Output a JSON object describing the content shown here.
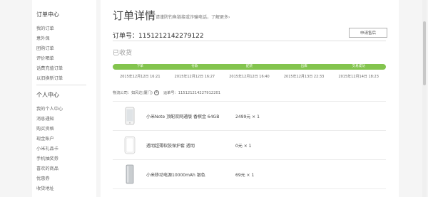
{
  "sidebar": {
    "groups": [
      {
        "title": "订单中心",
        "items": [
          "我的订单",
          "意外保",
          "团购订单",
          "评价晒单",
          "话费充值订单",
          "以旧换新订单"
        ]
      },
      {
        "title": "个人中心",
        "items": [
          "我的个人中心",
          "消息通知",
          "购买资格",
          "现金账户",
          "小米礼品卡",
          "手机抽奖券",
          "喜欢的商品",
          "优惠券",
          "收货地址"
        ]
      }
    ]
  },
  "main": {
    "title": "订单详情",
    "hint": "请谨防钓鱼链接或诈骗电话，了解更多›",
    "order_label": "订单号：",
    "order_number": "1151212142279122",
    "aftersale_button": "申请售后",
    "status": "已收货",
    "progress_steps": [
      "下单",
      "付款",
      "配货",
      "出库",
      "交易成功"
    ],
    "progress_times": [
      "2015年12月12日 16:21",
      "2015年12月12日 16:27",
      "2015年12月12日 16:40",
      "2015年12月13日 22:33",
      "2015年12月14日 18:23"
    ],
    "logistics": {
      "company_label": "物流公司：如风达(厦门)",
      "tracking_label": "运单号：",
      "tracking_number": "115121214227912201"
    },
    "products": [
      {
        "name": "小米Note 顶配双网通版 香槟金 64GB",
        "price": "2499元 × 1",
        "icon": "phone-icon"
      },
      {
        "name": "透明超薄软胶保护套 透明",
        "price": "0元 × 1",
        "icon": "case-icon"
      },
      {
        "name": "小米移动电源10000mAh 银色",
        "price": "69元 × 1",
        "icon": "power-bank-icon"
      }
    ]
  },
  "colors": {
    "progress": "#83c44e",
    "background": "#f5f5f5"
  }
}
